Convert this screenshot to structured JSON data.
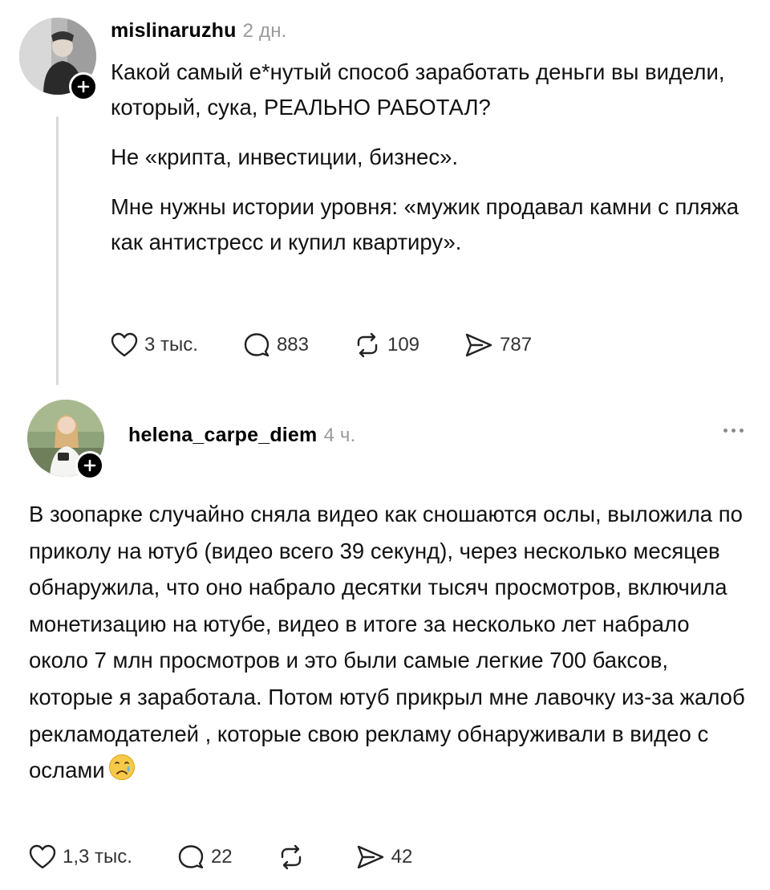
{
  "posts": [
    {
      "username": "mislinaruzhu",
      "time": "2 дн.",
      "paragraphs": [
        "Какой самый е*нутый способ заработать деньги вы видели, который, сука, РЕАЛЬНО РАБОТАЛ?",
        "Не «крипта, инвестиции, бизнес».",
        "Мне нужны истории уровня: «мужик продавал камни с пляжа как антистресс и купил квартиру»."
      ],
      "stats": {
        "likes": "3 тыс.",
        "comments": "883",
        "reposts": "109",
        "shares": "787"
      }
    },
    {
      "username": "helena_carpe_diem",
      "time": "4 ч.",
      "paragraphs": [
        "В зоопарке случайно сняла видео как сношаются ослы, выложила по приколу на ютуб (видео всего 39 секунд), через несколько месяцев обнаружила, что оно набрало десятки тысяч просмотров, включила монетизацию на ютубе, видео в итоге за несколько лет набрало около 7 млн просмотров и это были самые легкие 700 баксов, которые я заработала. Потом ютуб прикрыл мне лавочку из-за жалоб рекламодателей , которые свою рекламу обнаруживали в видео с ослами"
      ],
      "stats": {
        "likes": "1,3 тыс.",
        "comments": "22",
        "reposts": "",
        "shares": "42"
      }
    }
  ],
  "icons": {
    "like": "heart-icon",
    "comment": "comment-icon",
    "repost": "repost-icon",
    "share": "share-icon",
    "follow": "plus-icon",
    "more": "more-icon",
    "emoji": "crying-face-emoji"
  },
  "colors": {
    "text": "#111111",
    "muted": "#9a9a9a",
    "thread": "#d9d9d9"
  }
}
